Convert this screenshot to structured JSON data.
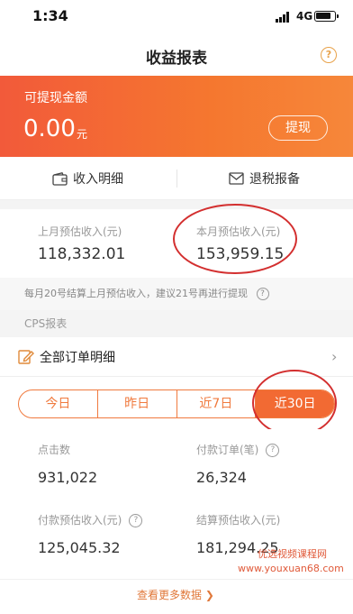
{
  "status_bar": {
    "time": "1:34",
    "network": "4G"
  },
  "nav": {
    "title": "收益报表",
    "help_glyph": "?"
  },
  "balance": {
    "label": "可提现金额",
    "amount": "0.00",
    "unit": "元",
    "withdraw_label": "提现"
  },
  "actions": {
    "income_detail": "收入明细",
    "tax_refund": "退税报备"
  },
  "estimate": {
    "last_month_label": "上月预估收入(元)",
    "last_month_value": "118,332.01",
    "this_month_label": "本月预估收入(元)",
    "this_month_value": "153,959.15"
  },
  "notice": {
    "text": "每月20号结算上月预估收入，建议21号再进行提现"
  },
  "cps": {
    "section_label": "CPS报表",
    "all_orders_label": "全部订单明细"
  },
  "tabs": [
    {
      "label": "今日"
    },
    {
      "label": "昨日"
    },
    {
      "label": "近7日"
    },
    {
      "label": "近30日"
    }
  ],
  "active_tab": "近30日",
  "stats": {
    "clicks_label": "点击数",
    "clicks_value": "931,022",
    "paid_orders_label": "付款订单(笔)",
    "paid_orders_value": "26,324",
    "paid_est_label": "付款预估收入(元)",
    "paid_est_value": "125,045.32",
    "settle_est_label": "结算预估收入(元)",
    "settle_est_value": "181,294.25"
  },
  "more": {
    "label": "查看更多数据 ❯"
  },
  "watermark": {
    "line1": "优选视频课程网",
    "line2": "www.youxuan68.com"
  },
  "colors": {
    "accent": "#f26a33",
    "annotation_red": "#d32f2f"
  }
}
